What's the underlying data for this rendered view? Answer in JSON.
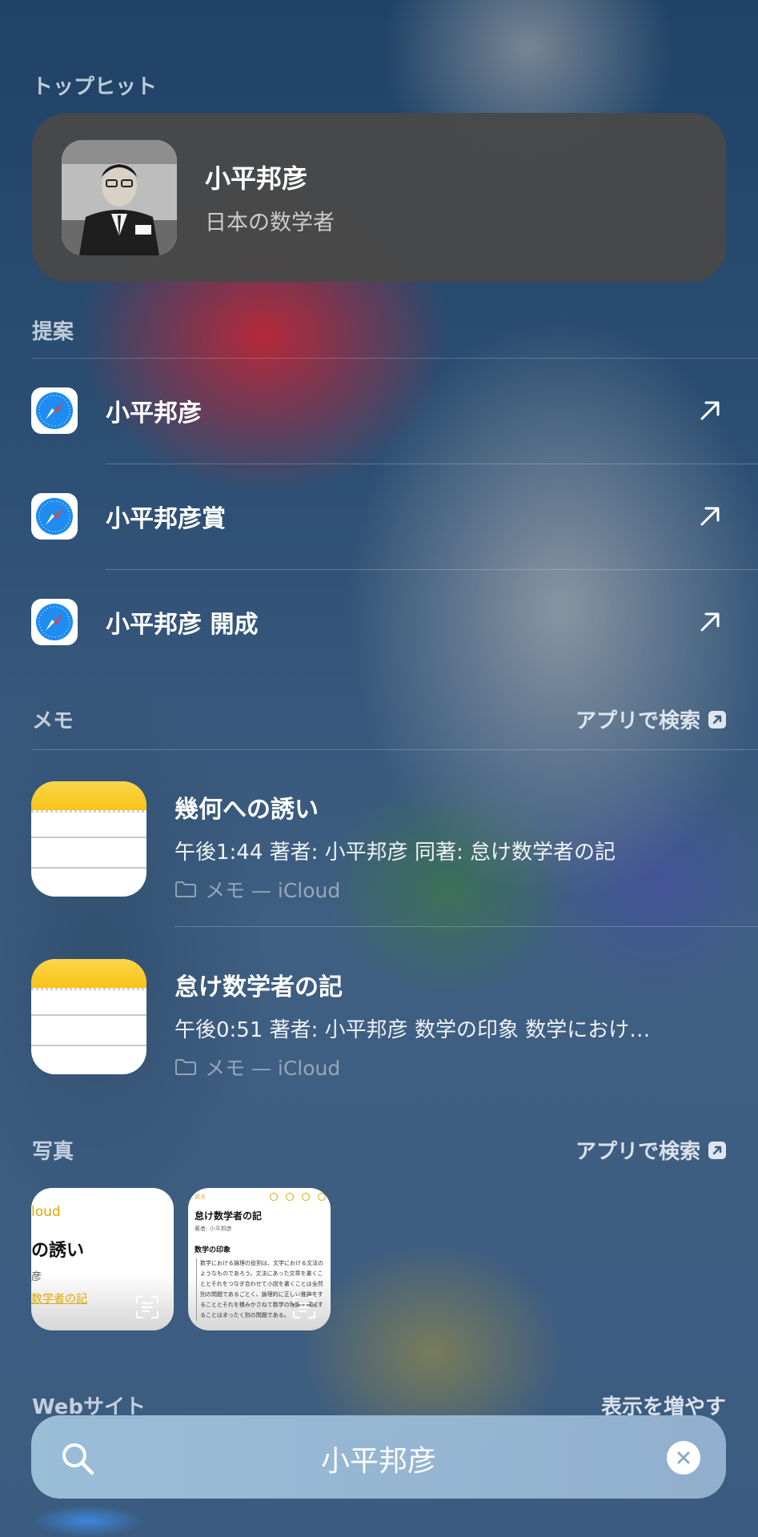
{
  "top_hits": {
    "header": "トップヒット",
    "title": "小平邦彦",
    "subtitle": "日本の数学者"
  },
  "suggestions": {
    "header": "提案",
    "items": [
      {
        "label": "小平邦彦"
      },
      {
        "label": "小平邦彦賞"
      },
      {
        "label": "小平邦彦 開成"
      }
    ]
  },
  "notes": {
    "header": "メモ",
    "search_in_app": "アプリで検索",
    "items": [
      {
        "title": "幾何への誘い",
        "subtitle": "午後1:44  著者: 小平邦彦 同著: 怠け数学者の記",
        "location": "メモ — iCloud"
      },
      {
        "title": "怠け数学者の記",
        "subtitle": "午後0:51  著者: 小平邦彦 数学の印象 数学におけ…",
        "location": "メモ — iCloud"
      }
    ]
  },
  "photos": {
    "header": "写真",
    "search_in_app": "アプリで検索",
    "photo1": {
      "line1": "loud",
      "line2": "の誘い",
      "line3": "彦",
      "line4": "数学者の記"
    },
    "photo2": {
      "back": "戻る",
      "title": "怠け数学者の記",
      "author": "著者: 小平邦彦",
      "heading": "数学の印象",
      "body": "数学における論理の役割は、文学における文法のようなものであろう。文法にあった文章を書くこととそれをつなぎ合わせて小説を書くことは全然別の問題であるごとく、論理的に正しい推論をすることとそれを積みかさねて数学の理論を構成することはまったく別の問題である。"
    }
  },
  "websites": {
    "header": "Webサイト",
    "show_more": "表示を増やす"
  },
  "search": {
    "query": "小平邦彦"
  },
  "colors": {
    "top_hit_card": "#484848",
    "notes_yellow": "#f9c418",
    "safari_blue": "#1e8cf0",
    "search_bar": "#a0c3dc"
  }
}
